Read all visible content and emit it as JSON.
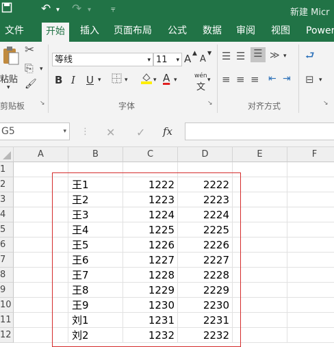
{
  "window": {
    "title": "新建 Micr"
  },
  "ribbon_tabs": [
    "文件",
    "开始",
    "插入",
    "页面布局",
    "公式",
    "数据",
    "审阅",
    "视图",
    "Power"
  ],
  "clipboard": {
    "cut": "✂",
    "copy": "⎘",
    "paste": "粘贴",
    "format": "🖌"
  },
  "font": {
    "name": "等线",
    "size": "11",
    "grow": "A",
    "shrink": "A",
    "bold": "B",
    "italic": "I",
    "underline": "U",
    "font_color_label": "A",
    "phonetic": "wén"
  },
  "groups": {
    "clipboard": "剪贴板",
    "font": "字体",
    "alignment": "对齐方式"
  },
  "formula_bar": {
    "name_box": "G5",
    "fx": "fx",
    "cancel": "✕",
    "confirm": "✓",
    "value": ""
  },
  "columns": [
    "A",
    "B",
    "C",
    "D",
    "E",
    "F"
  ],
  "rows": [
    {
      "num": "1",
      "b": "",
      "c": "",
      "d": ""
    },
    {
      "num": "2",
      "b": "王1",
      "c": "1222",
      "d": "2222"
    },
    {
      "num": "3",
      "b": "王2",
      "c": "1223",
      "d": "2223"
    },
    {
      "num": "4",
      "b": "王3",
      "c": "1224",
      "d": "2224"
    },
    {
      "num": "5",
      "b": "王4",
      "c": "1225",
      "d": "2225"
    },
    {
      "num": "6",
      "b": "王5",
      "c": "1226",
      "d": "2226"
    },
    {
      "num": "7",
      "b": "王6",
      "c": "1227",
      "d": "2227"
    },
    {
      "num": "8",
      "b": "王7",
      "c": "1228",
      "d": "2228"
    },
    {
      "num": "9",
      "b": "王8",
      "c": "1229",
      "d": "2229"
    },
    {
      "num": "10",
      "b": "王9",
      "c": "1230",
      "d": "2230"
    },
    {
      "num": "11",
      "b": "刘1",
      "c": "1231",
      "d": "2231"
    },
    {
      "num": "12",
      "b": "刘2",
      "c": "1232",
      "d": "2232"
    }
  ],
  "colors": {
    "accent": "#217346",
    "highlight_border": "#d42a2a"
  }
}
